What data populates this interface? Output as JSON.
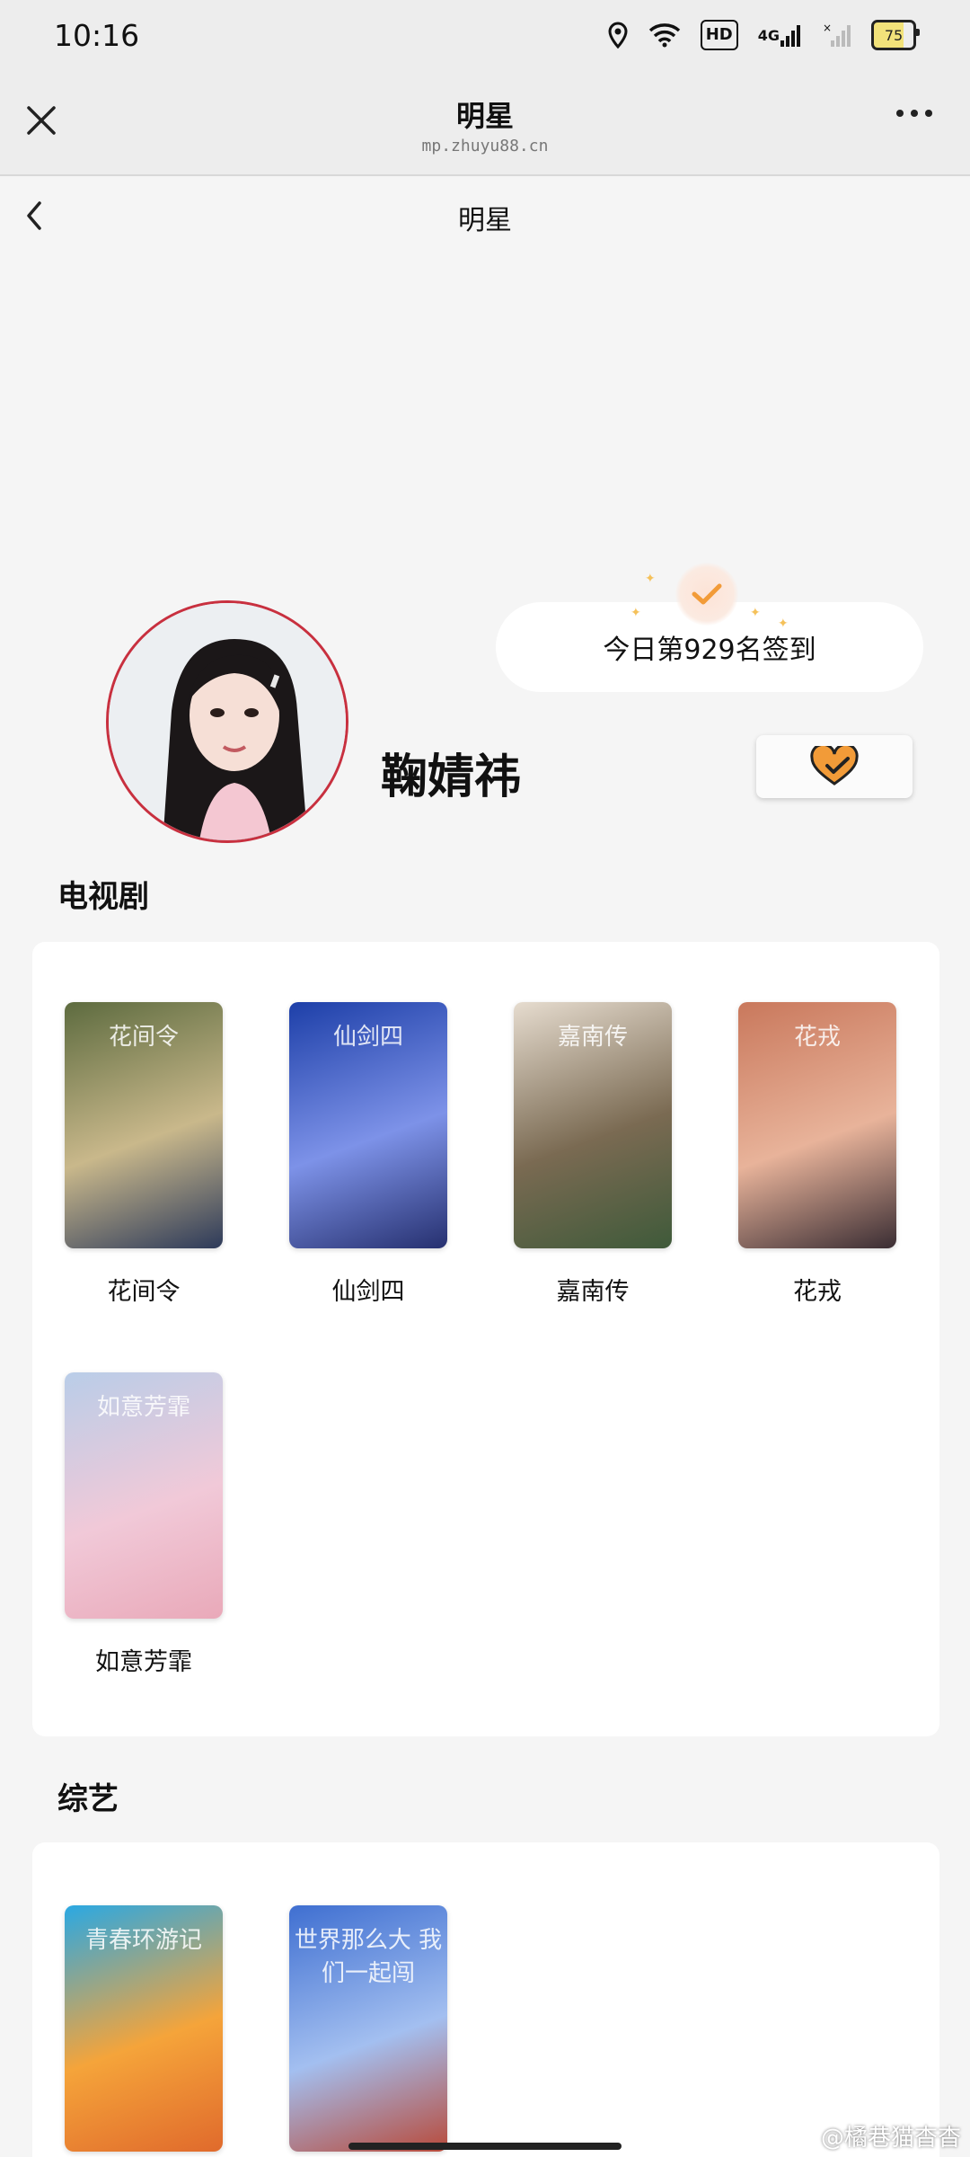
{
  "status_bar": {
    "time": "10:16",
    "network_label": "HD",
    "signal_label": "4G",
    "battery_level": "75"
  },
  "nav": {
    "title": "明星",
    "subtitle": "mp.zhuyu88.cn"
  },
  "subnav": {
    "title": "明星"
  },
  "profile": {
    "name": "鞠婧祎",
    "signin_text": "今日第929名签到"
  },
  "sections": {
    "tv": {
      "title": "电视剧",
      "items": [
        {
          "label": "花间令",
          "poster_text": "花间令",
          "colors": [
            "#5d6b3f",
            "#c9b88b",
            "#2d3a5a"
          ]
        },
        {
          "label": "仙剑四",
          "poster_text": "仙剑四",
          "colors": [
            "#1d3fa8",
            "#7d92e8",
            "#26306f"
          ]
        },
        {
          "label": "嘉南传",
          "poster_text": "嘉南传",
          "colors": [
            "#e6dccf",
            "#7a6a52",
            "#3f5a3a"
          ]
        },
        {
          "label": "花戎",
          "poster_text": "花戎",
          "colors": [
            "#c9785c",
            "#e8b39a",
            "#3a2d33"
          ]
        },
        {
          "label": "如意芳霏",
          "poster_text": "如意芳霏",
          "colors": [
            "#b9cde8",
            "#f1c9d8",
            "#e9a9b9"
          ]
        }
      ]
    },
    "variety": {
      "title": "综艺",
      "items": [
        {
          "label": "青春环游记",
          "poster_text": "青春环游记",
          "colors": [
            "#2aa8e3",
            "#f5a43a",
            "#e06a2c"
          ]
        },
        {
          "label": "世界那么大我们一起闯",
          "poster_text": "世界那么大 我们一起闯",
          "colors": [
            "#3f6fd1",
            "#a3bff0",
            "#b84a3a"
          ]
        }
      ]
    }
  },
  "watermark": "@橘巷猫杳杳",
  "accent_color": "#f29b38"
}
